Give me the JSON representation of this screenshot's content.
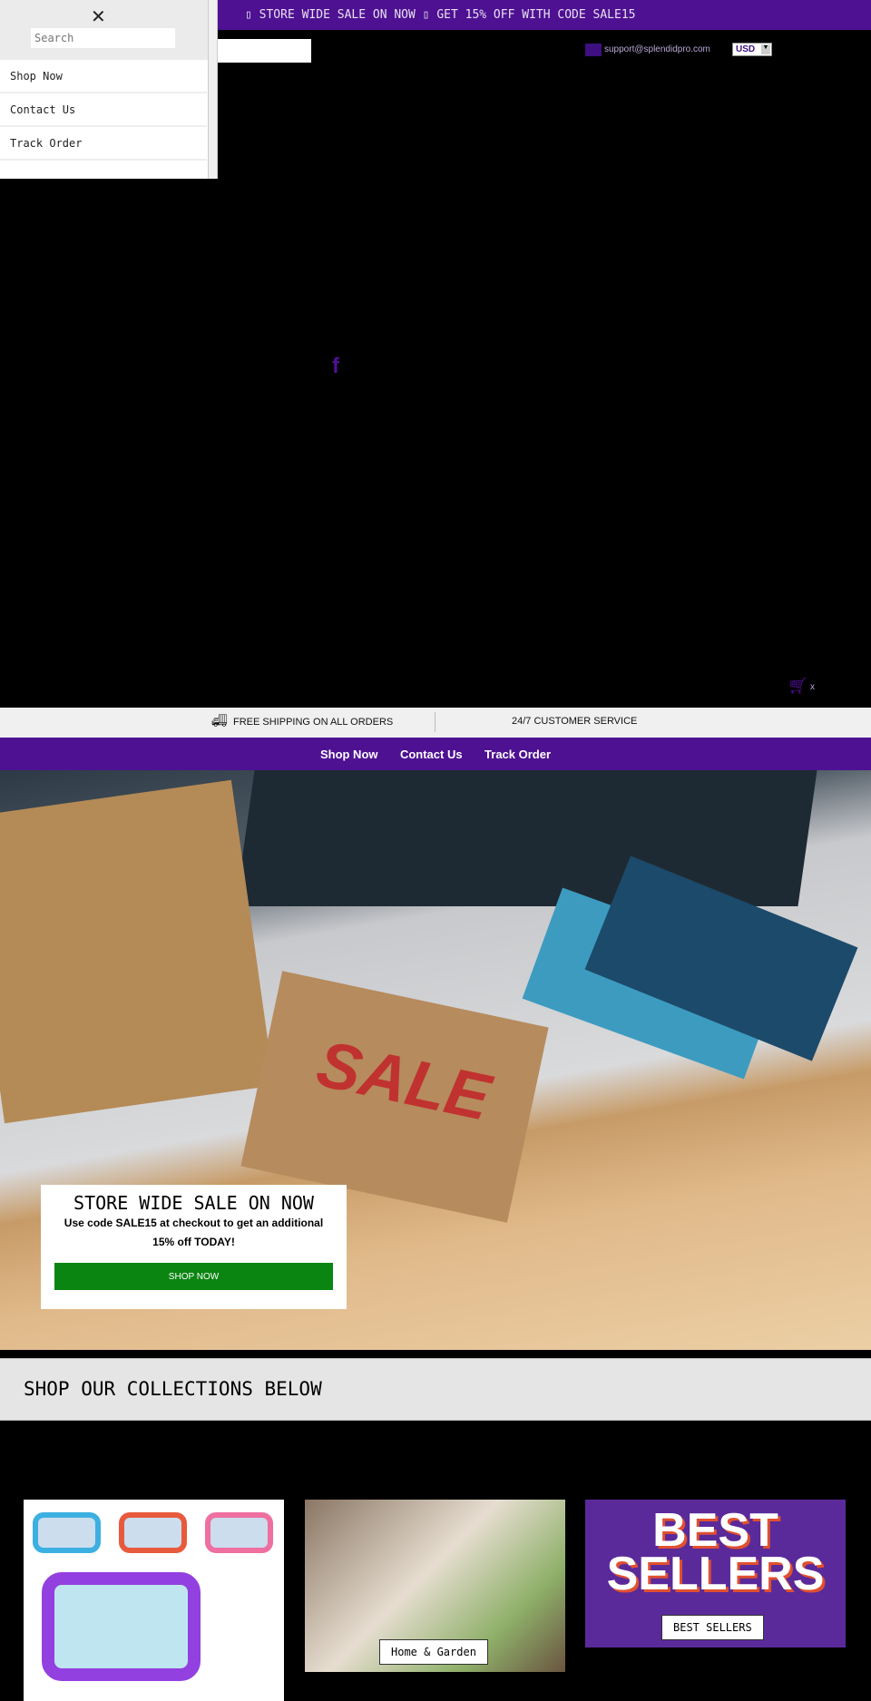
{
  "announcement": "▯ STORE WIDE SALE ON NOW ▯ GET 15% OFF WITH CODE SALE15",
  "header": {
    "email": "support@splendidpro.com",
    "currency": "USD"
  },
  "drawer": {
    "search_placeholder": "Search",
    "items": [
      {
        "label": "Shop Now"
      },
      {
        "label": "Contact Us"
      },
      {
        "label": "Track Order"
      }
    ]
  },
  "cart": {
    "count": "x"
  },
  "info_bar": {
    "shipping": "FREE SHIPPING ON ALL ORDERS",
    "service": "24/7 CUSTOMER SERVICE"
  },
  "nav": {
    "items": [
      {
        "label": "Shop Now"
      },
      {
        "label": "Contact Us"
      },
      {
        "label": "Track Order"
      }
    ]
  },
  "hero": {
    "tag_text": "SALE",
    "title": "STORE WIDE SALE ON NOW",
    "subtitle": "Use code SALE15 at checkout to get an additional 15% off TODAY!",
    "button": "SHOP NOW"
  },
  "collections": {
    "heading": "SHOP OUR COLLECTIONS BELOW",
    "cards": [
      {
        "label": ""
      },
      {
        "label": "Home & Garden"
      },
      {
        "label": "BEST SELLERS",
        "image_text": "BEST SELLERS"
      }
    ]
  },
  "colors": {
    "brand": "#4e1192",
    "button": "#0b8512"
  }
}
